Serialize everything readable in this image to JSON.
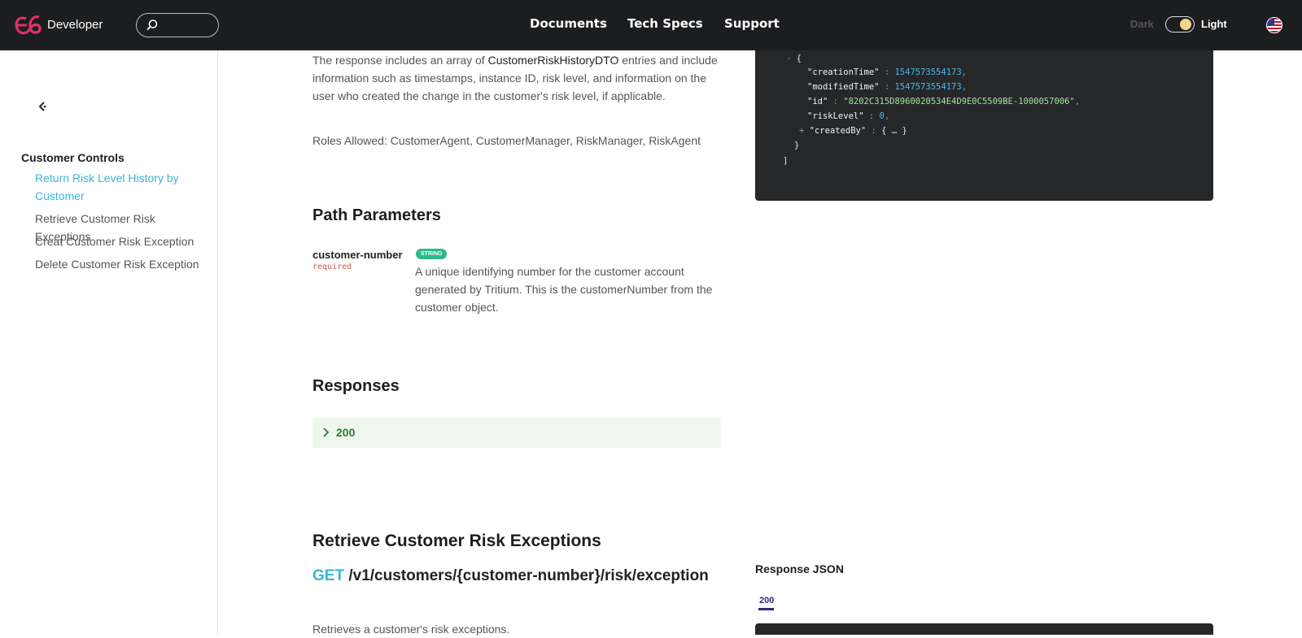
{
  "header": {
    "brand": "Developer",
    "nav": [
      "Documents",
      "Tech Specs",
      "Support"
    ],
    "theme_dark": "Dark",
    "theme_light": "Light"
  },
  "sidebar": {
    "section_title": "Customer Controls",
    "items": [
      {
        "label": "Return Risk Level History by Customer",
        "active": true
      },
      {
        "label": "Retrieve Customer Risk Exceptions",
        "active": false
      },
      {
        "label": "Creat Customer Risk Exception",
        "active": false
      },
      {
        "label": "Delete Customer Risk Exception",
        "active": false
      }
    ]
  },
  "main": {
    "intro_prefix": "The response includes an array of ",
    "intro_dto": "CustomerRiskHistoryDTO",
    "intro_suffix": " entries and include information such as timestamps, instance ID, risk level, and information on the user who created the change in the customer's risk level, if applicable.",
    "roles": "Roles Allowed: CustomerAgent, CustomerManager, RiskManager, RiskAgent",
    "path_params_title": "Path Parameters",
    "param": {
      "name": "customer-number",
      "required": "required",
      "type": "STRING",
      "description": "A unique identifying number for the customer account generated by Tritium. This is the customerNumber from the customer object."
    },
    "responses_title": "Responses",
    "response_code": "200",
    "next_section_title": "Retrieve Customer Risk Exceptions",
    "next_method": "GET",
    "next_path": "/v1/customers/{customer-number}/risk/exception",
    "next_description": "Retrieves a customer's risk exceptions."
  },
  "code_sample": {
    "open_brace": "{",
    "creation_time_key": "\"creationTime\"",
    "creation_time_val": "1547573554173",
    "modified_time_key": "\"modifiedTime\"",
    "modified_time_val": "1547573554173",
    "id_key": "\"id\"",
    "id_val": "\"8202C315D8960020534E4D9E0C5509BE-1000057006\"",
    "risk_level_key": "\"riskLevel\"",
    "risk_level_val": "0",
    "created_by_key": "\"createdBy\"",
    "created_by_val": "{ … }",
    "close_brace": "}",
    "close_bracket": "]"
  },
  "response_json": {
    "title": "Response JSON",
    "tab": "200"
  },
  "colors": {
    "topbar": "#1c1d1f",
    "accent": "#3ab5d8",
    "badge": "#2bb98a",
    "code_bg": "#262729"
  }
}
